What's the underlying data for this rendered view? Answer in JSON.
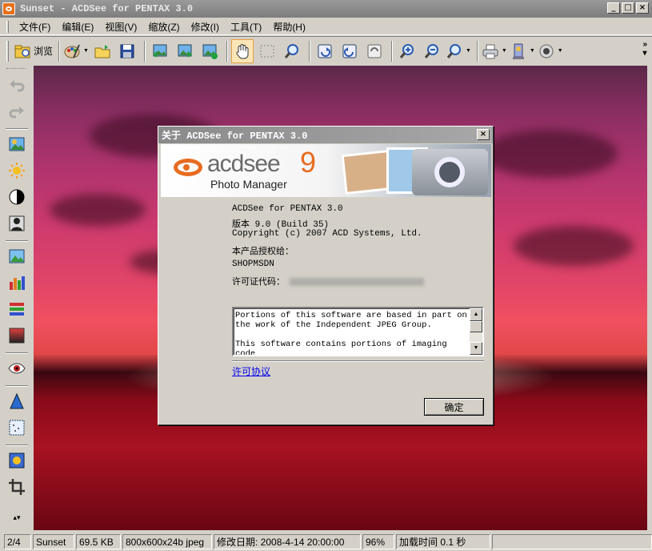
{
  "window": {
    "title": "Sunset - ACDSee for PENTAX 3.0"
  },
  "menu": [
    "文件(F)",
    "编辑(E)",
    "视图(V)",
    "缩放(Z)",
    "修改(I)",
    "工具(T)",
    "帮助(H)"
  ],
  "toolbar": {
    "browse_label": "浏览"
  },
  "dialog": {
    "title": "关于 ACDSee for PENTAX 3.0",
    "logo_text": "acdsee",
    "logo_version": "9",
    "logo_subtitle": "Photo Manager",
    "product_line": "ACDSee for PENTAX 3.0",
    "version_line": "版本 9.0 (Build 35)",
    "copyright_line": "Copyright (c) 2007 ACD Systems, Ltd.",
    "licensed_to_label": "本产品授权给：",
    "licensed_to_value": "SHOPMSDN",
    "license_code_label": "许可证代码：",
    "notice_text": "Portions of this software are based in part on\nthe work of the Independent JPEG Group.\n\nThis software contains portions of imaging code",
    "license_link": "许可协议",
    "ok_label": "确定"
  },
  "status": {
    "position": "2/4",
    "file_name": "Sunset",
    "file_size": "69.5 KB",
    "dimensions": "800x600x24b jpeg",
    "modified": "修改日期: 2008-4-14 20:00:00",
    "zoom": "96%",
    "load_time": "加载时间 0.1 秒"
  }
}
